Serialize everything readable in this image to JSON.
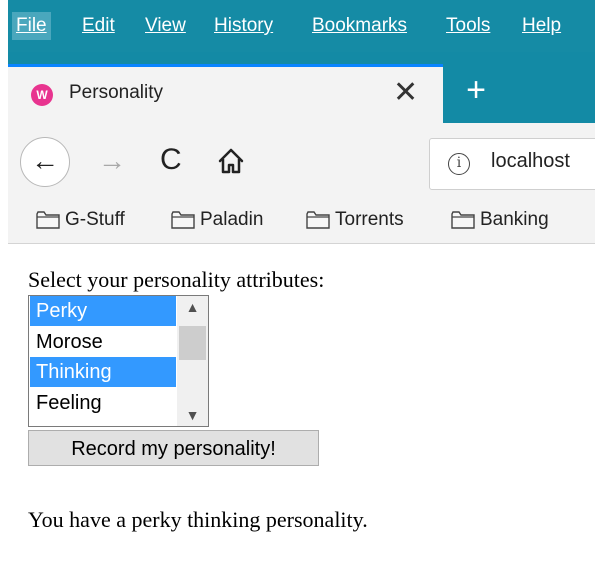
{
  "menubar": {
    "items": [
      {
        "label": "File"
      },
      {
        "label": "Edit"
      },
      {
        "label": "View"
      },
      {
        "label": "History"
      },
      {
        "label": "Bookmarks"
      },
      {
        "label": "Tools"
      },
      {
        "label": "Help"
      }
    ]
  },
  "tab": {
    "title": "Personality",
    "favicon_letter": "W",
    "close_glyph": "✕",
    "new_tab_glyph": "+"
  },
  "nav": {
    "back_glyph": "←",
    "forward_glyph": "→",
    "reload_glyph": "C",
    "url": "localhost",
    "info_glyph": "i"
  },
  "bookmarks": {
    "items": [
      {
        "label": "G-Stuff"
      },
      {
        "label": "Paladin"
      },
      {
        "label": "Torrents"
      },
      {
        "label": "Banking"
      }
    ]
  },
  "page": {
    "prompt": "Select your personality attributes:",
    "options": [
      {
        "label": "Perky",
        "selected": true
      },
      {
        "label": "Morose",
        "selected": false
      },
      {
        "label": "Thinking",
        "selected": true
      },
      {
        "label": "Feeling",
        "selected": false
      }
    ],
    "button_label": "Record my personality!",
    "result": "You have a perky thinking personality."
  },
  "colors": {
    "titlebar": "#158ba5",
    "selection": "#3399ff",
    "tab_accent": "#0a84ff"
  }
}
